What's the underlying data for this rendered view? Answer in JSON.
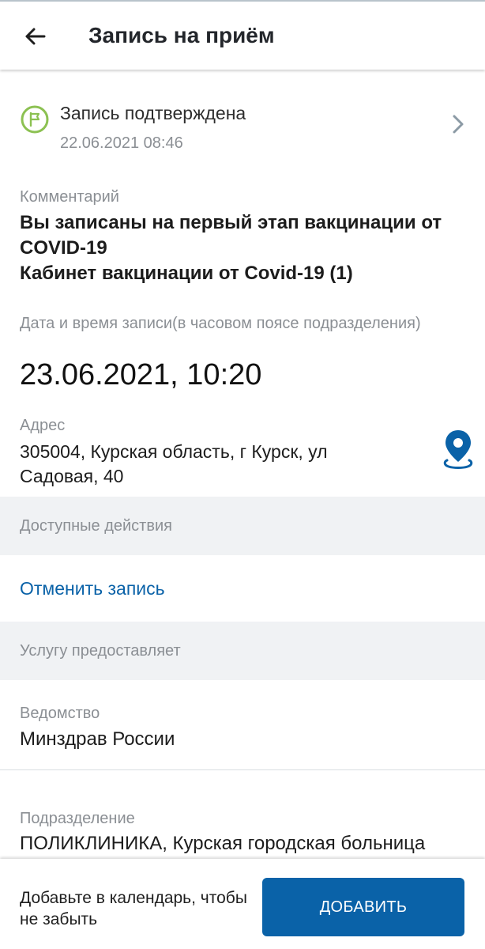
{
  "header": {
    "title": "Запись на приём"
  },
  "status": {
    "title": "Запись подтверждена",
    "date": "22.06.2021 08:46",
    "icon": "flag-icon",
    "color": "#8cc152"
  },
  "comment": {
    "label": "Комментарий",
    "lines": [
      "Вы записаны на первый этап вакцинации от COVID-19",
      "Кабинет вакцинации от Covid-19 (1)"
    ]
  },
  "appointment": {
    "label": "Дата и время записи(в часовом поясе подразделения)",
    "value": "23.06.2021, 10:20"
  },
  "address": {
    "label": "Адрес",
    "value": "305004, Курская область, г Курск, ул Садовая, 40",
    "icon": "map-pin-icon"
  },
  "actions": {
    "header": "Доступные действия",
    "cancel": "Отменить запись"
  },
  "provider": {
    "header": "Услугу предоставляет",
    "department_label": "Ведомство",
    "department_value": "Минздрав России",
    "subdivision_label": "Подразделение",
    "subdivision_value": "ПОЛИКЛИНИКА, Курская городская больница"
  },
  "calendar": {
    "text": "Добавьте в календарь, чтобы не забыть",
    "button": "ДОБАВИТЬ"
  },
  "colors": {
    "accent": "#0a62a8",
    "muted": "#8b8f94",
    "band": "#f0f2f4"
  }
}
